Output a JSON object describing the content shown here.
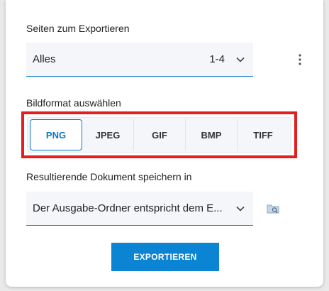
{
  "pages": {
    "label": "Seiten zum Exportieren",
    "selected": "Alles",
    "range": "1-4",
    "chevron_icon": "chevron-down-icon",
    "more_icon": "more-vert-icon"
  },
  "format": {
    "label": "Bildformat auswählen",
    "options": [
      "PNG",
      "JPEG",
      "GIF",
      "BMP",
      "TIFF"
    ],
    "selected": "PNG"
  },
  "save": {
    "label": "Resultierende Dokument speichern in",
    "selected": "Der Ausgabe-Ordner entspricht dem E...",
    "folder_icon": "folder-search-icon"
  },
  "export_button": "EXPORTIEREN",
  "colors": {
    "accent": "#0a79c9",
    "button": "#0b84d4",
    "highlight": "#e41e1e"
  }
}
